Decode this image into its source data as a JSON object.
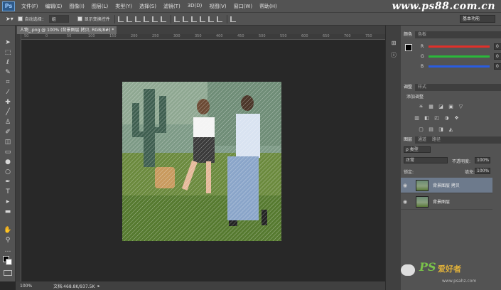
{
  "app": {
    "logo": "Ps",
    "site_watermark": "www.ps88.com.cn"
  },
  "menu": [
    "文件(F)",
    "编辑(E)",
    "图像(I)",
    "图层(L)",
    "类型(Y)",
    "选择(S)",
    "滤镜(T)",
    "3D(D)",
    "视图(V)",
    "窗口(W)",
    "帮助(H)"
  ],
  "options_bar": {
    "auto_select_label": "自动选择：",
    "auto_select_value": "组",
    "show_transform_label": "显示变换控件"
  },
  "workspace": "基本功能",
  "document": {
    "tab_title": "人物_.png @ 100% (背景图层 拷贝, RGB/8#) *",
    "zoom": "100%",
    "doc_size": "文档:468.8K/937.5K"
  },
  "ruler_ticks": [
    "50",
    "0",
    "50",
    "100",
    "150",
    "200",
    "250",
    "300",
    "350",
    "400",
    "450",
    "500",
    "550",
    "600",
    "650",
    "700",
    "750"
  ],
  "panels": {
    "color_tabs": [
      "颜色",
      "色板"
    ],
    "color_rows": [
      {
        "label": "R",
        "value": "0",
        "color": "#e0302a"
      },
      {
        "label": "G",
        "value": "0",
        "color": "#2ab83a"
      },
      {
        "label": "B",
        "value": "0",
        "color": "#2a5ce0"
      }
    ],
    "adj_tabs": [
      "调整",
      "样式"
    ],
    "adj_title": "添加调整",
    "layers_tabs": [
      "图层",
      "通道",
      "路径"
    ],
    "kind_label": "ρ 类型",
    "blend_mode": "正常",
    "opacity_label": "不透明度:",
    "opacity_value": "100%",
    "lock_label": "锁定:",
    "fill_label": "填充:",
    "fill_value": "100%",
    "layers": [
      {
        "name": "背景图层 拷贝",
        "selected": true
      },
      {
        "name": "背景图层",
        "selected": false
      }
    ]
  },
  "watermark": {
    "brand": "PS",
    "text": "爱好者",
    "url": "www.psahz.com"
  }
}
